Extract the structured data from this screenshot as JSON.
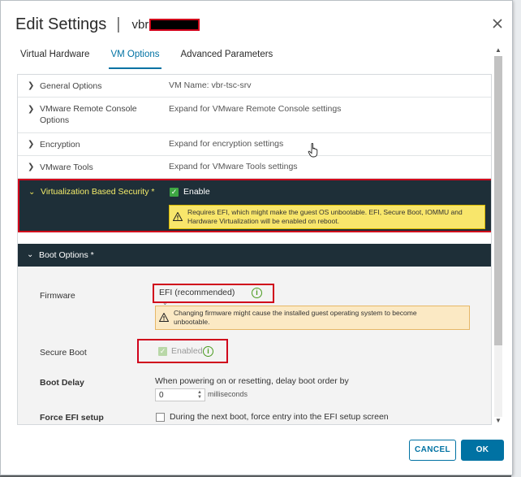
{
  "dialog": {
    "title": "Edit Settings",
    "separator": "|",
    "vm_name_prefix": "vbr",
    "close_icon": "close-icon"
  },
  "tabs": [
    {
      "label": "Virtual Hardware",
      "active": false
    },
    {
      "label": "VM Options",
      "active": true
    },
    {
      "label": "Advanced Parameters",
      "active": false
    }
  ],
  "sections": [
    {
      "label": "General Options",
      "value": "VM Name: vbr-tsc-srv"
    },
    {
      "label_line1": "VMware Remote Console",
      "label_line2": "Options",
      "value": "Expand for VMware Remote Console settings"
    },
    {
      "label": "Encryption",
      "value": "Expand for encryption settings"
    },
    {
      "label": "VMware Tools",
      "value": "Expand for VMware Tools settings"
    }
  ],
  "vbs": {
    "label": "Virtualization Based Security *",
    "enable_label": "Enable",
    "enabled": true,
    "warning_line1": "Requires EFI, which might make the guest OS unbootable. EFI, Secure Boot, IOMMU and",
    "warning_line2": "Hardware Virtualization will be enabled on reboot."
  },
  "boot_options": {
    "label": "Boot Options *",
    "firmware_label": "Firmware",
    "firmware_value": "EFI (recommended)",
    "firmware_warning_line1": "Changing firmware might cause the installed guest operating system to become",
    "firmware_warning_line2": "unbootable.",
    "secure_boot_label": "Secure Boot",
    "secure_boot_value": "Enabled",
    "secure_boot_checked": true,
    "boot_delay_label": "Boot Delay",
    "boot_delay_text": "When powering on or resetting, delay boot order by",
    "boot_delay_value": "0",
    "boot_delay_unit": "milliseconds",
    "force_efi_label": "Force EFI setup",
    "force_efi_text": "During the next boot, force entry into the EFI setup screen",
    "force_efi_checked": false
  },
  "footer": {
    "cancel_label": "CANCEL",
    "ok_label": "OK"
  },
  "colors": {
    "accent": "#0072a3",
    "header_dark": "#1e2f38",
    "highlight_red": "#d0021b",
    "warning_yellow": "#f8e66b"
  }
}
